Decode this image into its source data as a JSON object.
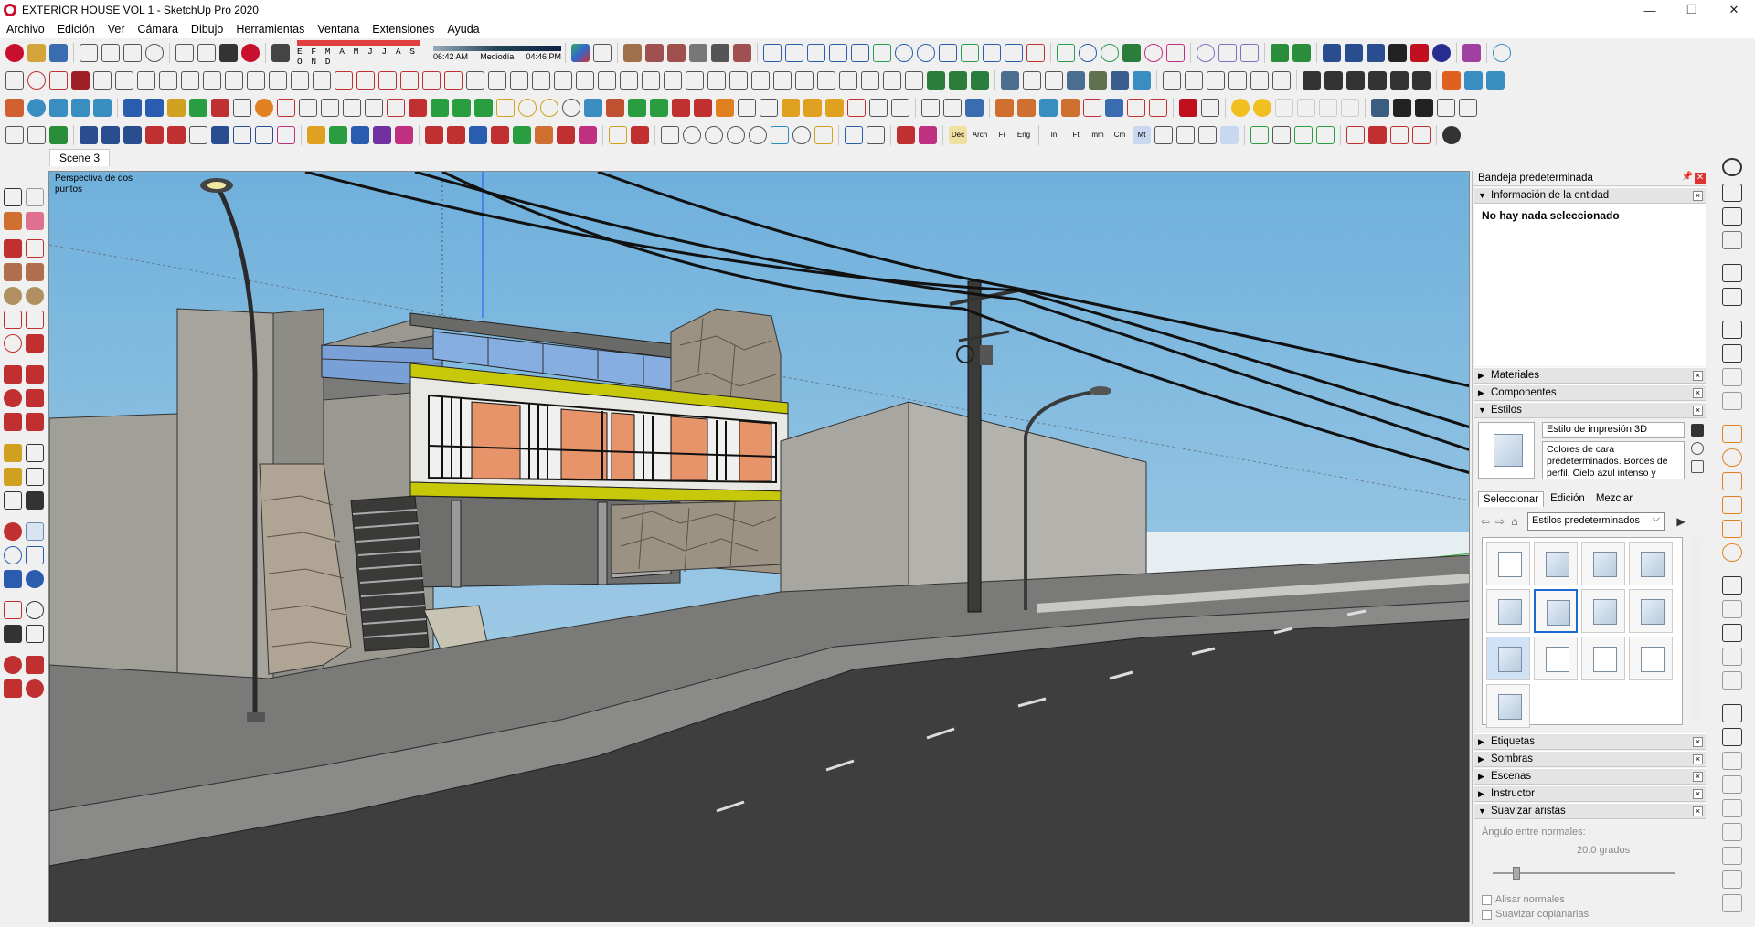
{
  "window": {
    "title": "EXTERIOR HOUSE VOL 1 - SketchUp Pro 2020",
    "controls": [
      "—",
      "❐",
      "✕"
    ]
  },
  "menu": [
    "Archivo",
    "Edición",
    "Ver",
    "Cámara",
    "Dibujo",
    "Herramientas",
    "Ventana",
    "Extensiones",
    "Ayuda"
  ],
  "shadow_settings": {
    "months": "E F M A M J J A S O N D",
    "time_start": "06:42 AM",
    "time_mid": "Mediodía",
    "time_end": "04:46 PM"
  },
  "units_toolbar": [
    "Dec",
    "Arch",
    "Fi",
    "Eng",
    "In",
    "Ft",
    "mm",
    "Cm",
    "Mt"
  ],
  "scene_tabs": [
    "Scene 3"
  ],
  "viewport": {
    "camera_label": "Perspectiva de dos puntos"
  },
  "tray": {
    "title": "Bandeja predeterminada",
    "panels": {
      "entity_info": "Información de la entidad",
      "entity_info_text": "No hay nada seleccionado",
      "materials": "Materiales",
      "components": "Componentes",
      "styles": "Estilos",
      "tags": "Etiquetas",
      "shadows": "Sombras",
      "scenes": "Escenas",
      "instructor": "Instructor",
      "soften_edges": "Suavizar aristas"
    },
    "styles": {
      "name": "Estilo de impresión 3D",
      "description": "Colores de cara predeterminados. Bordes de perfil. Cielo azul intenso y",
      "tabs": [
        "Seleccionar",
        "Edición",
        "Mezclar"
      ],
      "collection": "Estilos predeterminados"
    },
    "soften": {
      "angle_label": "Ángulo entre normales:",
      "angle_value": "20.0",
      "angle_unit": "grados",
      "smooth_normals": "Alisar normales",
      "soften_coplanar": "Suavizar coplanarias"
    }
  },
  "colors": {
    "sky": "#8fc2e0",
    "accent_yellow": "#c8c80a",
    "window_orange": "#e8946b",
    "concrete": "#a8a8a0",
    "road": "#4a4a4a"
  }
}
